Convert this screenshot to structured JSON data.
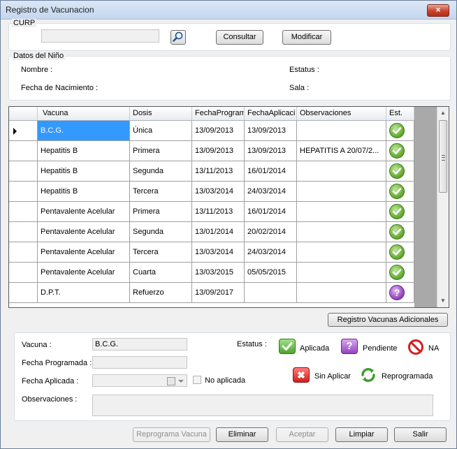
{
  "window": {
    "title": "Registro de Vacunacion",
    "close_glyph": "×"
  },
  "curp": {
    "legend": "CURP",
    "input_value": "",
    "search_icon": "magnifier-icon",
    "consultar_label": "Consultar",
    "modificar_label": "Modificar"
  },
  "datos": {
    "legend": "Datos del Niño",
    "nombre_label": "Nombre :",
    "fecha_nac_label": "Fecha de Nacimiento :",
    "estatus_label": "Estatus :",
    "sala_label": "Sala :"
  },
  "grid": {
    "columns": [
      "Vacuna",
      "Dosis",
      "FechaProgram",
      "FechaAplicaci",
      "Observaciones",
      "Est."
    ],
    "rows": [
      {
        "vacuna": "B.C.G.",
        "dosis": "Única",
        "fecha_prog": "13/09/2013",
        "fecha_apl": "13/09/2013",
        "obs": "",
        "status": "aplicada"
      },
      {
        "vacuna": "Hepatitis B",
        "dosis": "Primera",
        "fecha_prog": "13/09/2013",
        "fecha_apl": "13/09/2013",
        "obs": "HEPATITIS A 20/07/2...",
        "status": "aplicada"
      },
      {
        "vacuna": "Hepatitis B",
        "dosis": "Segunda",
        "fecha_prog": "13/11/2013",
        "fecha_apl": "16/01/2014",
        "obs": "",
        "status": "aplicada"
      },
      {
        "vacuna": "Hepatitis B",
        "dosis": "Tercera",
        "fecha_prog": "13/03/2014",
        "fecha_apl": "24/03/2014",
        "obs": "",
        "status": "aplicada"
      },
      {
        "vacuna": "Pentavalente Acelular",
        "dosis": "Primera",
        "fecha_prog": "13/11/2013",
        "fecha_apl": "16/01/2014",
        "obs": "",
        "status": "aplicada"
      },
      {
        "vacuna": "Pentavalente Acelular",
        "dosis": "Segunda",
        "fecha_prog": "13/01/2014",
        "fecha_apl": "20/02/2014",
        "obs": "",
        "status": "aplicada"
      },
      {
        "vacuna": "Pentavalente Acelular",
        "dosis": "Tercera",
        "fecha_prog": "13/03/2014",
        "fecha_apl": "24/03/2014",
        "obs": "",
        "status": "aplicada"
      },
      {
        "vacuna": "Pentavalente Acelular",
        "dosis": "Cuarta",
        "fecha_prog": "13/03/2015",
        "fecha_apl": "05/05/2015",
        "obs": "",
        "status": "aplicada"
      },
      {
        "vacuna": "D.P.T.",
        "dosis": "Refuerzo",
        "fecha_prog": "13/09/2017",
        "fecha_apl": "",
        "obs": "",
        "status": "pendiente"
      }
    ],
    "pendiente_glyph": "?"
  },
  "registro_adicionales_label": "Registro Vacunas Adicionales",
  "detail": {
    "vacuna_label": "Vacuna :",
    "vacuna_value": "B.C.G.",
    "fecha_prog_label": "Fecha Programada :",
    "fecha_prog_value": "",
    "fecha_apl_label": "Fecha Aplicada :",
    "no_aplicada_label": "No aplicada",
    "observaciones_label": "Observaciones :",
    "observaciones_value": "",
    "estatus_label": "Estatus :",
    "legend": {
      "aplicada": "Aplicada",
      "pendiente": "Pendiente",
      "na": "NA",
      "sin_aplicar": "Sin Aplicar",
      "reprogramada": "Reprogramada"
    },
    "glyphs": {
      "pendiente": "?",
      "sin_aplicar": "✖"
    }
  },
  "buttons": {
    "reprograma": "Reprograma Vacuna",
    "eliminar": "Eliminar",
    "aceptar": "Aceptar",
    "limpiar": "Limpiar",
    "salir": "Salir"
  }
}
